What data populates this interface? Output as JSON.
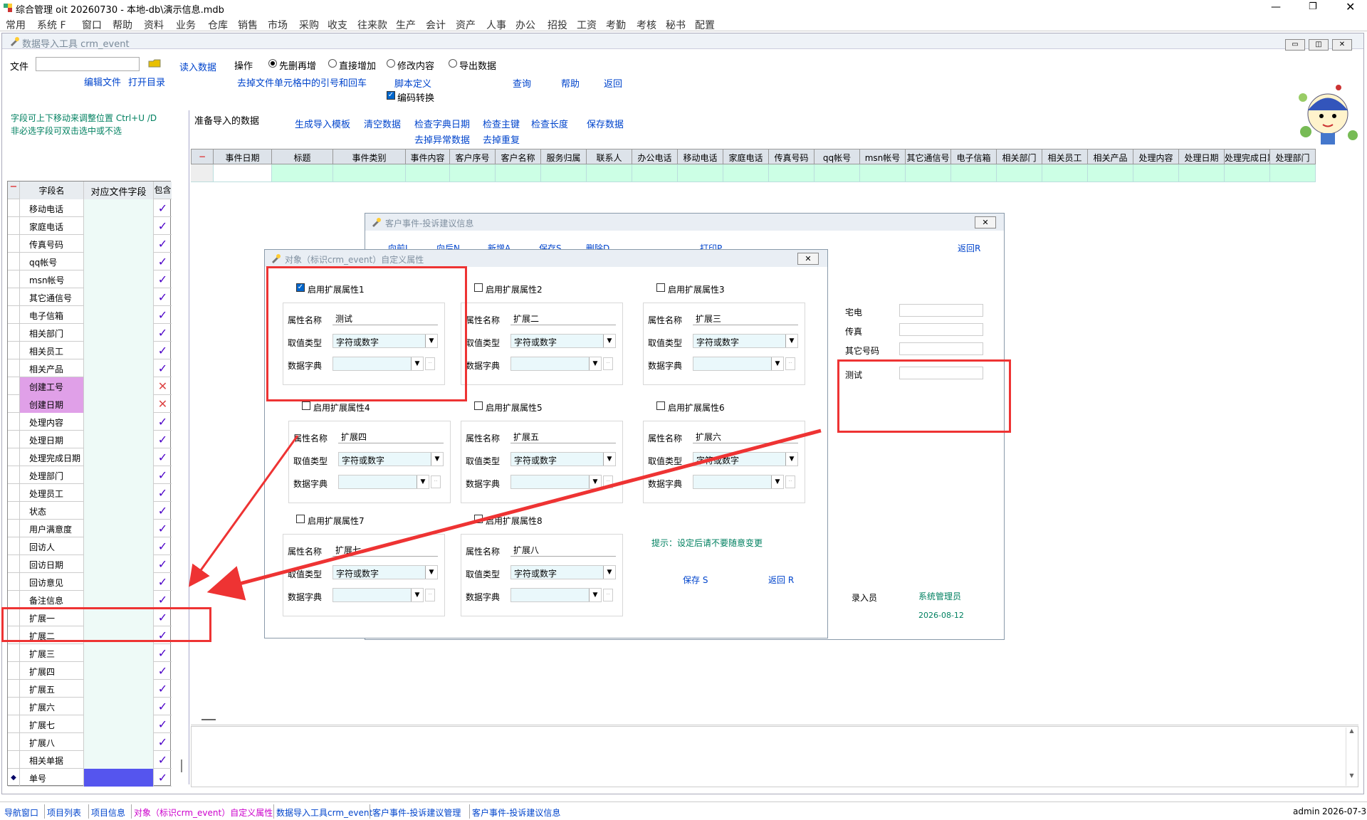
{
  "app": {
    "title": "综合管理 oit 20260730 - 本地-db\\演示信息.mdb"
  },
  "menu": [
    "常用",
    "系统 F",
    "窗口",
    "帮助",
    "资料",
    "业务",
    "仓库",
    "销售",
    "市场",
    "采购",
    "收支",
    "往来款",
    "生产",
    "会计",
    "资产",
    "人事",
    "办公",
    "招投",
    "工资",
    "考勤",
    "考核",
    "秘书",
    "配置"
  ],
  "importer": {
    "title": "数据导入工具 crm_event",
    "file_label": "文件",
    "read_data": "读入数据",
    "edit_file": "编辑文件",
    "open_dir": "打开目录",
    "op_label": "操作",
    "op_options": [
      "先删再增",
      "直接增加",
      "修改内容",
      "导出数据"
    ],
    "remove_quotes": "去掉文件单元格中的引号和回车",
    "script_def": "脚本定义",
    "encode": "编码转换",
    "query": "查询",
    "help": "帮助",
    "back": "返回",
    "hint1": "字段可上下移动来调整位置 Ctrl+U /D",
    "hint2": "非必选字段可双击选中或不选",
    "prep_label": "准备导入的数据",
    "actions_row1": [
      "生成导入模板",
      "清空数据",
      "检查字典日期",
      "检查主键",
      "检查长度",
      "保存数据"
    ],
    "actions_row2": [
      "去掉异常数据",
      "去掉重复"
    ]
  },
  "field_grid": {
    "headers": [
      "字段名",
      "对应文件字段",
      "包含"
    ],
    "rows": [
      {
        "name": "移动电话",
        "inc": true
      },
      {
        "name": "家庭电话",
        "inc": true
      },
      {
        "name": "传真号码",
        "inc": true
      },
      {
        "name": "qq帐号",
        "inc": true
      },
      {
        "name": "msn帐号",
        "inc": true
      },
      {
        "name": "其它通信号",
        "inc": true
      },
      {
        "name": "电子信箱",
        "inc": true
      },
      {
        "name": "相关部门",
        "inc": true
      },
      {
        "name": "相关员工",
        "inc": true
      },
      {
        "name": "相关产品",
        "inc": true
      },
      {
        "name": "创建工号",
        "inc": false
      },
      {
        "name": "创建日期",
        "inc": false
      },
      {
        "name": "处理内容",
        "inc": true
      },
      {
        "name": "处理日期",
        "inc": true
      },
      {
        "name": "处理完成日期",
        "inc": true
      },
      {
        "name": "处理部门",
        "inc": true
      },
      {
        "name": "处理员工",
        "inc": true
      },
      {
        "name": "状态",
        "inc": true
      },
      {
        "name": "用户满意度",
        "inc": true
      },
      {
        "name": "回访人",
        "inc": true
      },
      {
        "name": "回访日期",
        "inc": true
      },
      {
        "name": "回访意见",
        "inc": true
      },
      {
        "name": "备注信息",
        "inc": true
      },
      {
        "name": "扩展一",
        "inc": true
      },
      {
        "name": "扩展二",
        "inc": true
      },
      {
        "name": "扩展三",
        "inc": true
      },
      {
        "name": "扩展四",
        "inc": true
      },
      {
        "name": "扩展五",
        "inc": true
      },
      {
        "name": "扩展六",
        "inc": true
      },
      {
        "name": "扩展七",
        "inc": true
      },
      {
        "name": "扩展八",
        "inc": true
      },
      {
        "name": "相关单据",
        "inc": true
      },
      {
        "name": "单号",
        "inc": true
      }
    ]
  },
  "top_grid_headers": [
    "事件日期",
    "标题",
    "事件类别",
    "事件内容",
    "客户序号",
    "客户名称",
    "服务归属",
    "联系人",
    "办公电话",
    "移动电话",
    "家庭电话",
    "传真号码",
    "qq帐号",
    "msn帐号",
    "其它通信号",
    "电子信箱",
    "相关部门",
    "相关员工",
    "相关产品",
    "处理内容",
    "处理日期",
    "处理完成日期",
    "处理部门",
    "处理员工"
  ],
  "event_dlg": {
    "title": "客户事件-投诉建议信息",
    "toolbar": [
      "向前L",
      "向后N",
      "新增A",
      "保存S",
      "删除D",
      "打印P"
    ],
    "back": "返回R",
    "labels": [
      "宅电",
      "传真",
      "其它号码",
      "测试"
    ],
    "entry_label": "录入员",
    "entry_user": "系统管理员",
    "entry_date": "2026-08-12"
  },
  "attr_dlg": {
    "title": "对象（标识crm_event）自定义属性",
    "groups": [
      {
        "enable": "启用扩展属性1",
        "on": true,
        "name": "测试"
      },
      {
        "enable": "启用扩展属性2",
        "on": false,
        "name": "扩展二"
      },
      {
        "enable": "启用扩展属性3",
        "on": false,
        "name": "扩展三"
      },
      {
        "enable": "启用扩展属性4",
        "on": false,
        "name": "扩展四"
      },
      {
        "enable": "启用扩展属性5",
        "on": false,
        "name": "扩展五"
      },
      {
        "enable": "启用扩展属性6",
        "on": false,
        "name": "扩展六"
      },
      {
        "enable": "启用扩展属性7",
        "on": false,
        "name": "扩展七"
      },
      {
        "enable": "启用扩展属性8",
        "on": false,
        "name": "扩展八"
      }
    ],
    "attr_name_label": "属性名称",
    "value_type_label": "取值类型",
    "value_type": "字符或数字",
    "dict_label": "数据字典",
    "hint": "提示：设定后请不要随意变更",
    "save": "保存 S",
    "back": "返回 R"
  },
  "status_bar": {
    "items": [
      "导航窗口",
      "项目列表",
      "项目信息",
      "对象（标识crm_event）自定义属性",
      "数据导入工具crm_event",
      "客户事件-投诉建议管理",
      "客户事件-投诉建议信息"
    ],
    "user": "admin",
    "date": "2026-07-30"
  },
  "colors": {
    "accent": "#0044cc",
    "grid_green": "#ccffe5",
    "highlight_red": "#ee3333",
    "check_purple": "#4b00c8",
    "selected_cell": "#5555ee",
    "pink": "#e0a0e8"
  }
}
